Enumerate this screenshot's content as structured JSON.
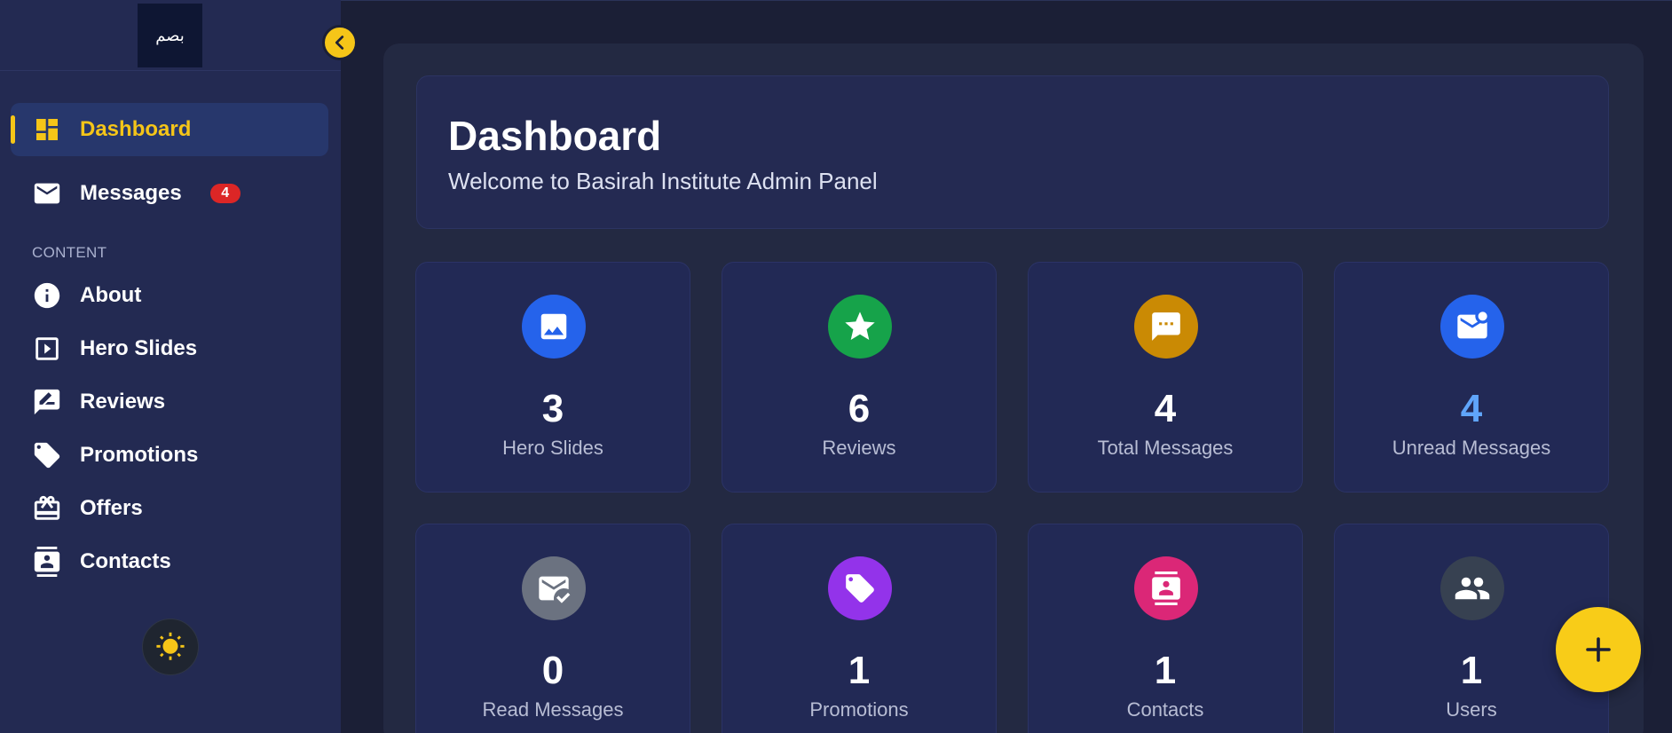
{
  "sidebar": {
    "logo_text": "بصم",
    "section_label": "CONTENT",
    "items": [
      {
        "label": "Dashboard",
        "icon": "dashboard-icon",
        "active": true
      },
      {
        "label": "Messages",
        "icon": "mail-icon",
        "badge": "4"
      },
      {
        "label": "About",
        "icon": "info-icon"
      },
      {
        "label": "Hero Slides",
        "icon": "slideshow-icon"
      },
      {
        "label": "Reviews",
        "icon": "rate-review-icon"
      },
      {
        "label": "Promotions",
        "icon": "tag-icon"
      },
      {
        "label": "Offers",
        "icon": "gift-icon"
      },
      {
        "label": "Contacts",
        "icon": "contacts-icon"
      }
    ],
    "theme_icon": "sun-icon",
    "collapse_icon": "chevron-left-icon"
  },
  "header": {
    "title": "Dashboard",
    "subtitle": "Welcome to Basirah Institute Admin Panel"
  },
  "stats": [
    {
      "value": "3",
      "label": "Hero Slides",
      "icon": "image-icon",
      "color": "#2563eb"
    },
    {
      "value": "6",
      "label": "Reviews",
      "icon": "star-icon",
      "color": "#16a34a"
    },
    {
      "value": "4",
      "label": "Total Messages",
      "icon": "chat-icon",
      "color": "#ca8a04"
    },
    {
      "value": "4",
      "label": "Unread Messages",
      "icon": "unread-mail-icon",
      "color": "#2563eb",
      "value_color": "#60a5fa"
    },
    {
      "value": "0",
      "label": "Read Messages",
      "icon": "read-mail-icon",
      "color": "#6b7280"
    },
    {
      "value": "1",
      "label": "Promotions",
      "icon": "tag-icon",
      "color": "#9333ea"
    },
    {
      "value": "1",
      "label": "Contacts",
      "icon": "contact-card-icon",
      "color": "#db2777"
    },
    {
      "value": "1",
      "label": "Users",
      "icon": "users-icon",
      "color": "#374151"
    }
  ],
  "fab": {
    "icon": "plus-icon"
  },
  "colors": {
    "accent": "#f5c518",
    "sidebar": "#232a52",
    "background": "#1b1f36"
  }
}
